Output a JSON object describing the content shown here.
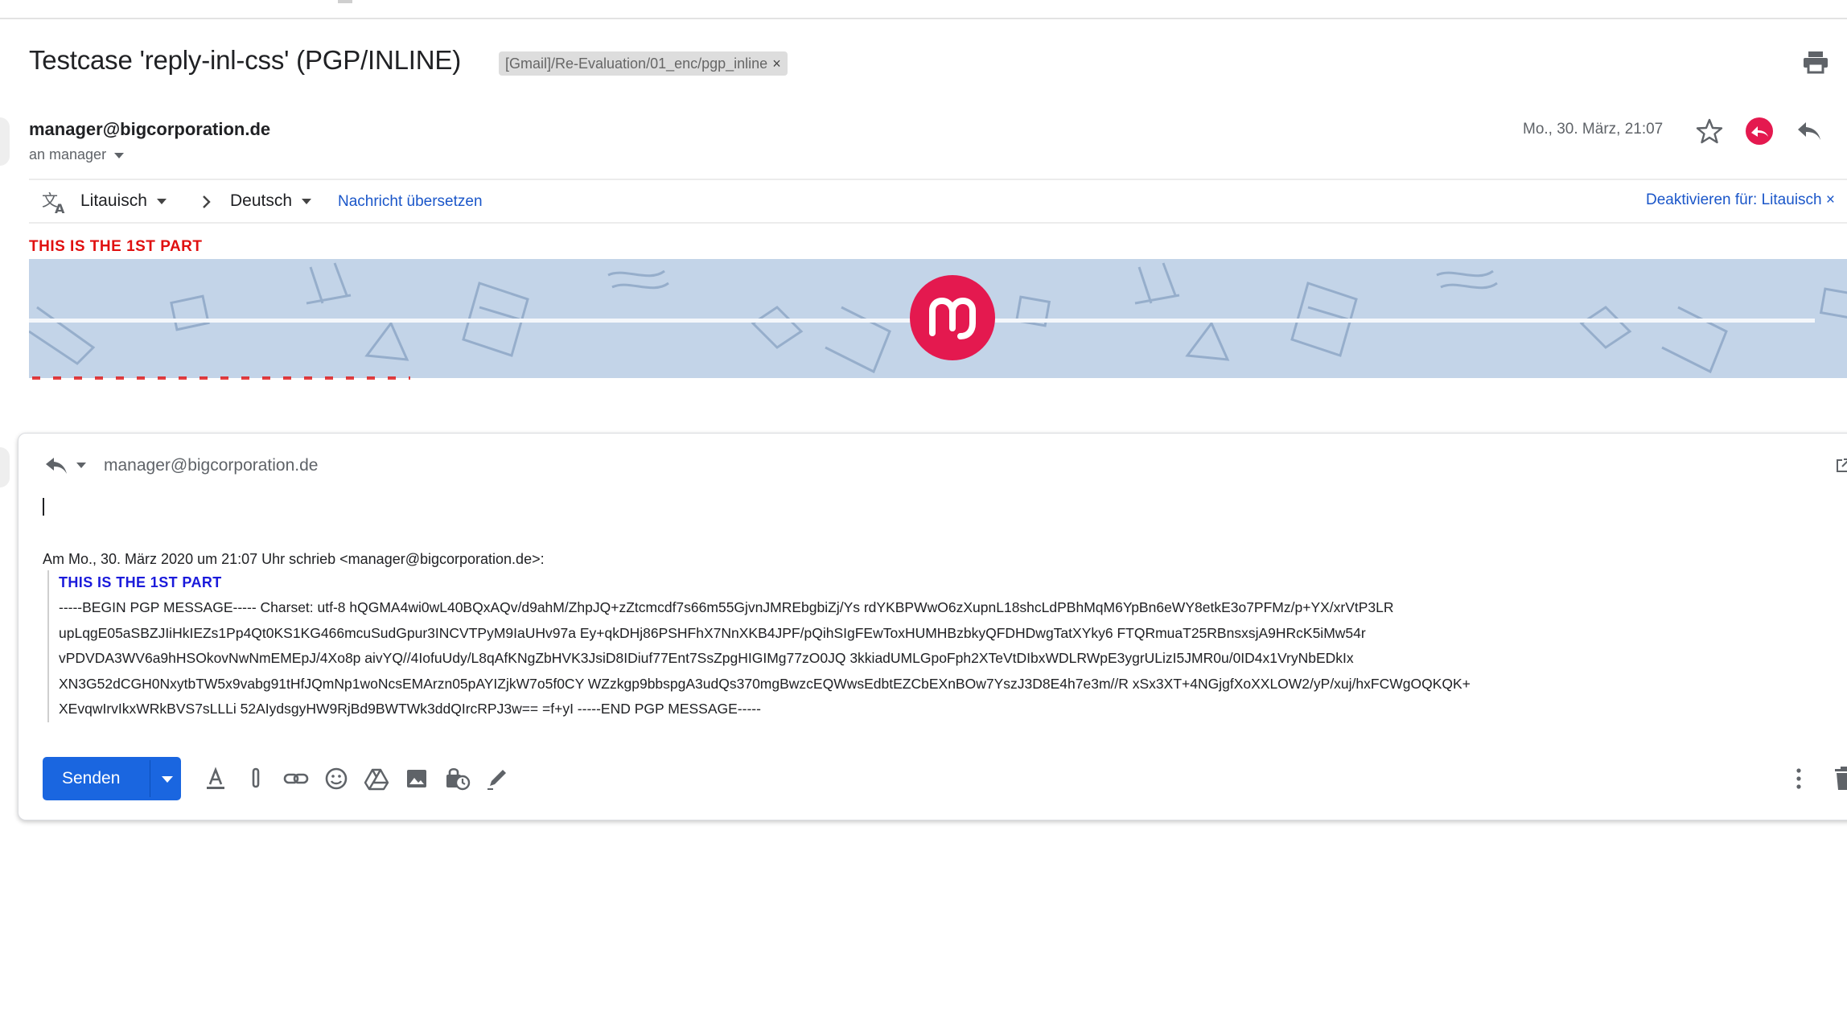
{
  "header": {
    "subject": "Testcase 'reply-inl-css' (PGP/INLINE)",
    "label_chip": "[Gmail]/Re-Evaluation/01_enc/pgp_inline",
    "label_chip_close": "×",
    "print_icon": "print-icon"
  },
  "message": {
    "sender": "manager@bigcorporation.de",
    "recipient_line": "an manager",
    "date": "Mo., 30. März, 21:07",
    "icons": [
      "star-icon",
      "mailvelope-icon",
      "reply-icon"
    ]
  },
  "translate_bar": {
    "source_language": "Litauisch",
    "target_language": "Deutsch",
    "translate_link": "Nachricht übersetzen",
    "deactivate_link": "Deaktivieren für: Litauisch ×"
  },
  "body": {
    "first_part": "THIS IS THE 1ST PART"
  },
  "compose": {
    "to": "manager@bigcorporation.de",
    "quote_header": "Am Mo., 30. März 2020 um 21:07 Uhr schrieb <manager@bigcorporation.de>:",
    "quote_first_part": "THIS IS THE 1ST PART",
    "quote_lines": [
      "-----BEGIN PGP MESSAGE----- Charset: utf-8 hQGMA4wi0wL40BQxAQv/d9ahM/ZhpJQ+zZtcmcdf7s66m55GjvnJMREbgbiZj/Ys rdYKBPWwO6zXupnL18shcLdPBhMqM6YpBn6eWY8etkE3o7PFMz/p+YX/xrVtP3LR",
      "upLqgE05aSBZJIiHkIEZs1Pp4Qt0KS1KG466mcuSudGpur3INCVTPyM9IaUHv97a Ey+qkDHj86PSHFhX7NnXKB4JPF/pQihSIgFEwToxHUMHBzbkyQFDHDwgTatXYky6 FTQRmuaT25RBnsxsjA9HRcK5iMw54r",
      "vPDVDA3WV6a9hHSOkovNwNmEMEpJ/4Xo8p aivYQ//4IofuUdy/L8qAfKNgZbHVK3JsiD8IDiuf77Ent7SsZpgHIGIMg77zO0JQ 3kkiadUMLGpoFph2XTeVtDIbxWDLRWpE3ygrULizI5JMR0u/0ID4x1VryNbEDkIx",
      "XN3G52dCGH0NxytbTW5x9vabg91tHfJQmNp1woNcsEMArzn05pAYIZjkW7o5f0CY WZzkgp9bbspgA3udQs370mgBwzcEQWwsEdbtEZCbEXnBOw7YszJ3D8E4h7e3m//R xSx3XT+4NGjgfXoXXLOW2/yP/xuj/hxFCWgOQKQK+",
      "XEvqwIrvIkxWRkBVS7sLLLi 52AIydsgyHW9RjBd9BWTWk3ddQIrcRPJ3w== =f+yI -----END PGP MESSAGE-----"
    ],
    "send_label": "Senden"
  },
  "colors": {
    "accent_blue": "#1a66e0",
    "link_blue": "#1a56c9",
    "red_text": "#e01010",
    "banner_bg": "#c3d4e8",
    "logo_red": "#e4194f"
  }
}
